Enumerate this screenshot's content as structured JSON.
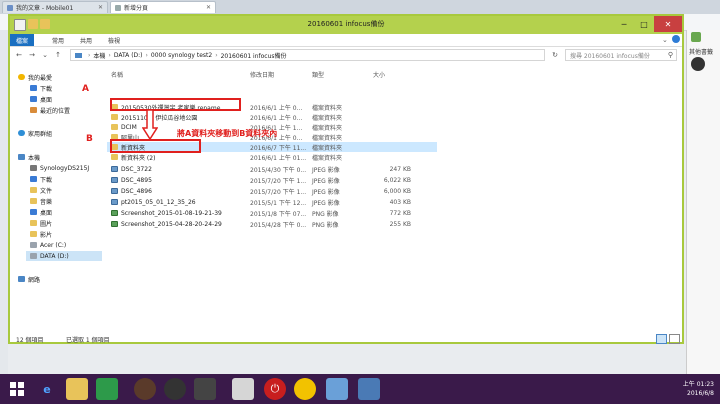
{
  "browser": {
    "tabs": [
      {
        "label": "我的文章 - Mobile01"
      },
      {
        "label": "新增分頁"
      }
    ],
    "side_label": "其他書籤"
  },
  "window": {
    "title": "20160601 infocus備份",
    "controls": {
      "min": "─",
      "max": "□",
      "close": "✕"
    }
  },
  "ribbon": {
    "tabs": [
      "檔案",
      "常用",
      "共用",
      "檢視"
    ]
  },
  "address": {
    "segments": [
      "本機",
      "DATA (D:)",
      "0000 synology test2",
      "20160601 infocus備份"
    ],
    "search_placeholder": "搜尋 20160601 infocus備份"
  },
  "navpane": {
    "items": [
      {
        "label": "我的最愛",
        "level": 0
      },
      {
        "label": "下載",
        "level": 1
      },
      {
        "label": "桌面",
        "level": 1
      },
      {
        "label": "最近的位置",
        "level": 1
      },
      {
        "label": "家用群組",
        "level": 0
      },
      {
        "label": "本機",
        "level": 0
      },
      {
        "label": "SynologyDS215J",
        "level": 1
      },
      {
        "label": "下載",
        "level": 1
      },
      {
        "label": "文件",
        "level": 1
      },
      {
        "label": "音樂",
        "level": 1
      },
      {
        "label": "桌面",
        "level": 1
      },
      {
        "label": "圖片",
        "level": 1
      },
      {
        "label": "影片",
        "level": 1
      },
      {
        "label": "Acer (C:)",
        "level": 1
      },
      {
        "label": "DATA (D:)",
        "level": 1
      },
      {
        "label": "網路",
        "level": 0
      }
    ]
  },
  "columns": [
    "名稱",
    "修改日期",
    "類型",
    "大小"
  ],
  "files": [
    {
      "name": "20150530外禪灣宇 老家樂 rename",
      "date": "2016/6/1 上午 0...",
      "type": "檔案資料夾",
      "size": "",
      "kind": "folder"
    },
    {
      "name": "2015110... 伊拉瓜谷地公園",
      "date": "2016/6/1 上午 0...",
      "type": "檔案資料夾",
      "size": "",
      "kind": "folder"
    },
    {
      "name": "DCIM",
      "date": "2016/6/1 上午 1...",
      "type": "檔案資料夾",
      "size": "",
      "kind": "folder"
    },
    {
      "name": "阿里山",
      "date": "2016/6/1 上午 0...",
      "type": "檔案資料夾",
      "size": "",
      "kind": "folder"
    },
    {
      "name": "新資料夾",
      "date": "2016/6/7 下午 11...",
      "type": "檔案資料夾",
      "size": "",
      "kind": "folder"
    },
    {
      "name": "新資料夾 (2)",
      "date": "2016/6/1 上午 01...",
      "type": "檔案資料夾",
      "size": "",
      "kind": "folder"
    },
    {
      "name": "DSC_3722",
      "date": "2015/4/30 下午 0...",
      "type": "JPEG 影像",
      "size": "247 KB",
      "kind": "jpeg"
    },
    {
      "name": "DSC_4895",
      "date": "2015/7/20 下午 1...",
      "type": "JPEG 影像",
      "size": "6,022 KB",
      "kind": "jpeg"
    },
    {
      "name": "DSC_4896",
      "date": "2015/7/20 下午 1...",
      "type": "JPEG 影像",
      "size": "6,000 KB",
      "kind": "jpeg"
    },
    {
      "name": "pt2015_05_01_12_35_26",
      "date": "2015/5/1 下午 12...",
      "type": "JPEG 影像",
      "size": "403 KB",
      "kind": "jpeg"
    },
    {
      "name": "Screenshot_2015-01-08-19-21-39",
      "date": "2015/1/8 下午 07...",
      "type": "PNG 影像",
      "size": "772 KB",
      "kind": "png"
    },
    {
      "name": "Screenshot_2015-04-28-20-24-29",
      "date": "2015/4/28 下午 0...",
      "type": "PNG 影像",
      "size": "255 KB",
      "kind": "png"
    }
  ],
  "status": {
    "count": "12 個項目",
    "selected": "已選取 1 個項目"
  },
  "annotations": {
    "label_a": "A",
    "label_b": "B",
    "instruction": "將A資料夾移動到B資料夾內",
    "accent": "#e0201e"
  },
  "taskbar": {
    "time": "上午 01:23",
    "date": "2016/6/8"
  },
  "colors": {
    "titlebar": "#b4d14d",
    "taskbar": "#3a1a4a",
    "selection": "#cce8ff"
  }
}
